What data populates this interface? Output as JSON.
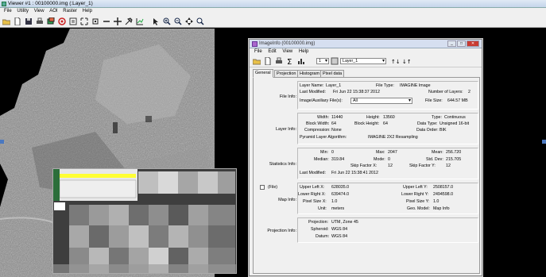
{
  "viewer": {
    "title": "Viewer #1 : 00100000.img (:Layer_1)",
    "menu": [
      "File",
      "Utility",
      "View",
      "AOI",
      "Raster",
      "Help"
    ]
  },
  "imageinfo": {
    "title": "ImageInfo (00100000.img)",
    "menu": [
      "File",
      "Edit",
      "View",
      "Help"
    ],
    "band_number": "1",
    "layer_select": "Layer_1",
    "tabs": [
      "General",
      "Projection",
      "Histogram",
      "Pixel data"
    ],
    "file_info": {
      "label": "File Info:",
      "layer_name_label": "Layer Name:",
      "layer_name": "Layer_1",
      "file_type_label": "File Type:",
      "file_type": "IMAGINE Image",
      "last_modified_label": "Last Modified:",
      "last_modified": "Fri Jun 22 15:38:37 2012",
      "num_layers_label": "Number of Layers:",
      "num_layers": "2",
      "aux_label": "Image/Auxiliary File(s):",
      "aux_value": "All",
      "file_size_label": "File Size:",
      "file_size": "644.57 MB"
    },
    "layer_info": {
      "label": "Layer Info:",
      "width_label": "Width:",
      "width": "11440",
      "height_label": "Height:",
      "height": "13560",
      "type_label": "Type:",
      "type": "Continuous",
      "block_width_label": "Block Width:",
      "block_width": "64",
      "block_height_label": "Block Height:",
      "block_height": "64",
      "data_type_label": "Data Type:",
      "data_type": "Unsigned 16-bit",
      "compression_label": "Compression:",
      "compression": "None",
      "data_order_label": "Data Order:",
      "data_order": "BIK",
      "pyramid_label": "Pyramid Layer Algorithm:",
      "pyramid": "IMAGINE 2X2 Resampling"
    },
    "stats_info": {
      "label": "Statistics Info:",
      "min_label": "Min:",
      "min": "0",
      "max_label": "Max:",
      "max": "2047",
      "mean_label": "Mean:",
      "mean": "256.720",
      "median_label": "Median:",
      "median": "319.84",
      "mode_label": "Mode:",
      "mode": "0",
      "std_label": "Std. Dev:",
      "std": "215.705",
      "skipx_label": "Skip Factor X:",
      "skipx": "12",
      "skipy_label": "Skip Factor Y:",
      "skipy": "12",
      "last_mod_label": "Last Modified:",
      "last_mod": "Fri Jun 22 15:38:41 2012"
    },
    "map_info": {
      "label": "Map Info:",
      "file_chk_label": "(File)",
      "ulx_label": "Upper Left X:",
      "ulx": "628035.0",
      "uly_label": "Upper Left Y:",
      "uly": "2508157.0",
      "lrx_label": "Lower Right X:",
      "lrx": "639474.0",
      "lry_label": "Lower Right Y:",
      "lry": "2494598.0",
      "psx_label": "Pixel Size X:",
      "psx": "1.0",
      "psy_label": "Pixel Size Y:",
      "psy": "1.0",
      "unit_label": "Unit:",
      "unit": "meters",
      "geo_label": "Geo. Model:",
      "geo": "Map Info"
    },
    "proj_info": {
      "label": "Projection Info:",
      "projection_label": "Projection:",
      "projection": "UTM, Zone 45",
      "spheroid_label": "Spheroid:",
      "spheroid": "WGS 84",
      "datum_label": "Datum:",
      "datum": "WGS 84"
    }
  },
  "overlay_number": "1",
  "colors": {
    "title_bg": "#d6dff0",
    "close_red": "#c83b32",
    "highlight_yellow": "#ffff33"
  }
}
